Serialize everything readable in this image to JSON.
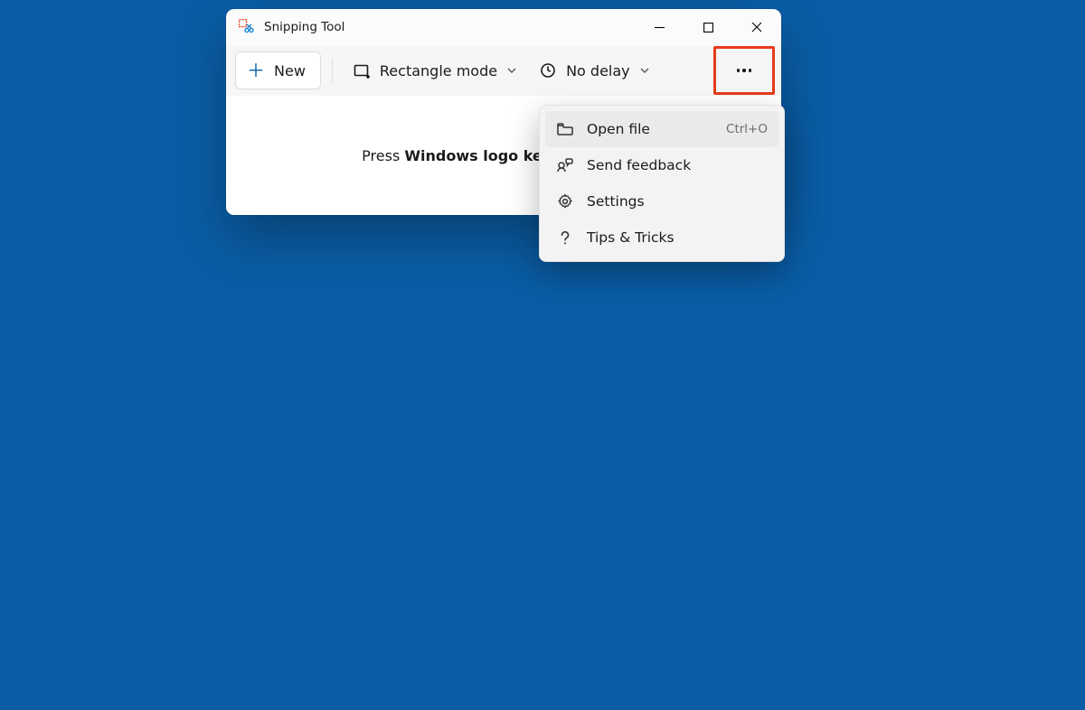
{
  "app": {
    "title": "Snipping Tool"
  },
  "toolbar": {
    "new_label": "New",
    "mode_label": "Rectangle mode",
    "delay_label": "No delay"
  },
  "hint": {
    "prefix": "Press ",
    "keys": "Windows logo key + Shift + S"
  },
  "menu": {
    "items": [
      {
        "icon": "folder-open-icon",
        "label": "Open file",
        "shortcut": "Ctrl+O",
        "hover": true
      },
      {
        "icon": "feedback-icon",
        "label": "Send feedback",
        "shortcut": "",
        "hover": false
      },
      {
        "icon": "settings-icon",
        "label": "Settings",
        "shortcut": "",
        "hover": false
      },
      {
        "icon": "help-icon",
        "label": "Tips & Tricks",
        "shortcut": "",
        "hover": false
      }
    ]
  }
}
